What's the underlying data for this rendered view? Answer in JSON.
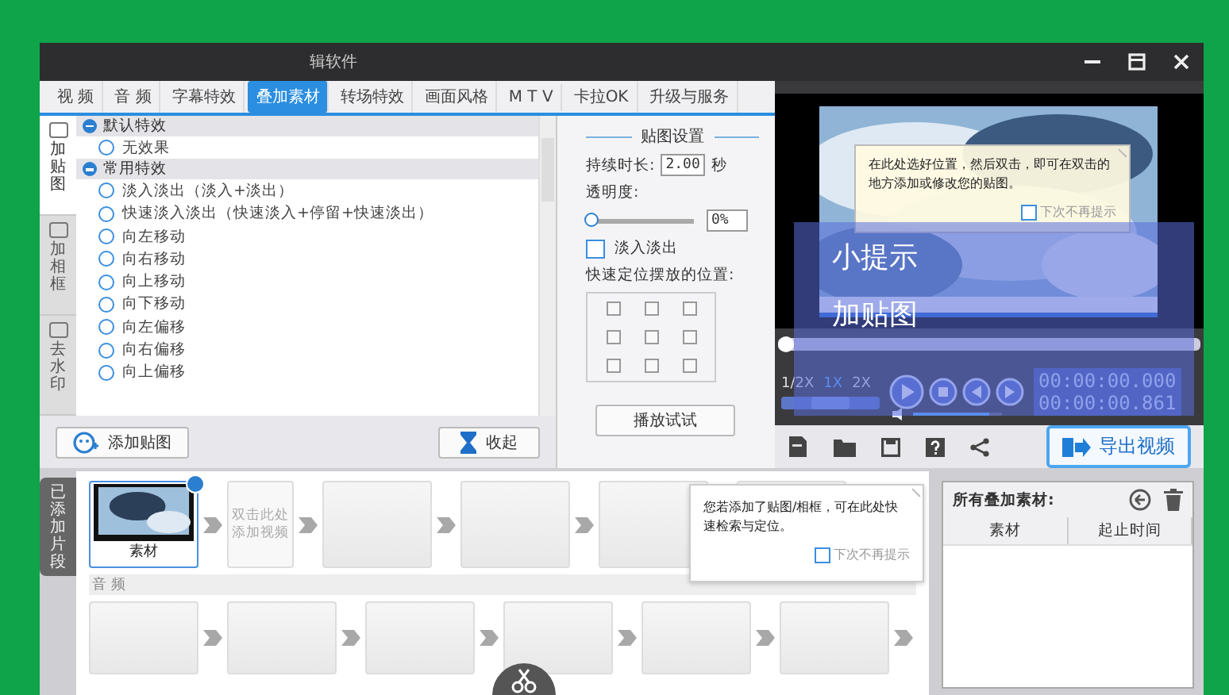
{
  "window": {
    "title": "辑软件"
  },
  "tabs": [
    {
      "label": "视 频",
      "selected": false
    },
    {
      "label": "音 频",
      "selected": false
    },
    {
      "label": "字幕特效",
      "selected": false
    },
    {
      "label": "叠加素材",
      "selected": true
    },
    {
      "label": "转场特效",
      "selected": false
    },
    {
      "label": "画面风格",
      "selected": false
    },
    {
      "label": "M T V",
      "selected": false
    },
    {
      "label": "卡拉OK",
      "selected": false
    },
    {
      "label": "升级与服务",
      "selected": false
    }
  ],
  "side_tabs": [
    {
      "label": "加贴图",
      "selected": true
    },
    {
      "label": "加相框",
      "selected": false
    },
    {
      "label": "去水印",
      "selected": false
    }
  ],
  "effect_groups": [
    {
      "name": "默认特效",
      "expanded": true,
      "items": [
        {
          "label": "无效果",
          "selected": false
        }
      ]
    },
    {
      "name": "常用特效",
      "expanded": true,
      "items": [
        {
          "label": "淡入淡出（淡入+淡出）",
          "selected": false
        },
        {
          "label": "快速淡入淡出（快速淡入+停留+快速淡出）",
          "selected": false
        },
        {
          "label": "向左移动",
          "selected": false
        },
        {
          "label": "向右移动",
          "selected": false
        },
        {
          "label": "向上移动",
          "selected": false
        },
        {
          "label": "向下移动",
          "selected": false
        },
        {
          "label": "向左偏移",
          "selected": false
        },
        {
          "label": "向右偏移",
          "selected": false
        },
        {
          "label": "向上偏移",
          "selected": false
        }
      ]
    }
  ],
  "left_buttons": {
    "add": "添加贴图",
    "collapse": "收起"
  },
  "settings": {
    "title": "贴图设置",
    "duration_label": "持续时长:",
    "duration": "2.00",
    "duration_unit": "秒",
    "opacity_label": "透明度:",
    "opacity_slider": {
      "level": 0
    },
    "opacity_value": "0%",
    "fade": {
      "label": "淡入淡出",
      "checked": false
    },
    "position_label": "快速定位摆放的位置:",
    "positions": [
      false,
      false,
      false,
      false,
      false,
      false,
      false,
      false,
      false
    ],
    "play_button": "播放试试"
  },
  "preview": {
    "tip": "在此处选好位置，然后双击，即可在双击的地方添加或修改您的贴图。",
    "tip_dismiss": {
      "label": "下次不再提示",
      "checked": false
    },
    "seek_bar": {
      "level": 0
    },
    "speed_slider": {
      "level": 0.5
    },
    "speeds": [
      {
        "label": "1/2X",
        "selected": false
      },
      {
        "label": "1X",
        "selected": true
      },
      {
        "label": "2X",
        "selected": false
      }
    ],
    "timecodes": [
      "00:00:00.000",
      "00:00:00.861"
    ],
    "volume": {
      "level": 0.85
    },
    "export_button": "导出视频"
  },
  "caption": [
    "小提示",
    "加贴图"
  ],
  "timeline": {
    "label": "已添加片段",
    "audio_label": "音 频",
    "video_slots": [
      {
        "kind": "clip",
        "label": "素材"
      },
      {
        "kind": "hint",
        "label": "双击此处添加视频"
      },
      {
        "kind": "empty"
      },
      {
        "kind": "empty"
      },
      {
        "kind": "empty"
      },
      {
        "kind": "empty"
      }
    ],
    "audio_slots": [
      {
        "kind": "empty"
      },
      {
        "kind": "empty"
      },
      {
        "kind": "empty"
      },
      {
        "kind": "empty"
      },
      {
        "kind": "empty"
      },
      {
        "kind": "empty"
      }
    ],
    "tip": "您若添加了贴图/相框，可在此处快速检索与定位。",
    "tip_dismiss": {
      "label": "下次不再提示",
      "checked": false
    }
  },
  "overlay_panel": {
    "title": "所有叠加素材:",
    "columns": [
      "素材",
      "起止时间"
    ]
  }
}
